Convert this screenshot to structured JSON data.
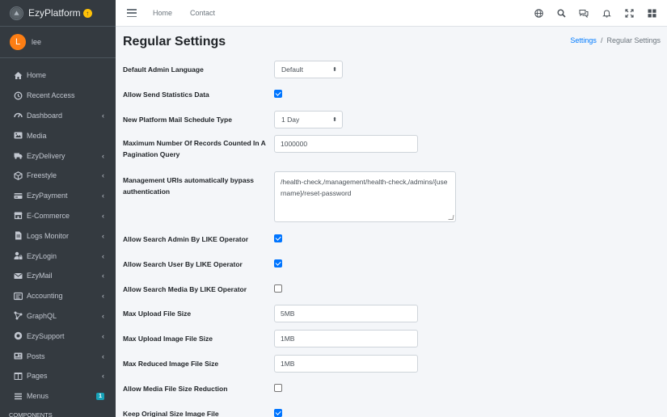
{
  "brand": {
    "name": "EzyPlatform"
  },
  "user": {
    "initial": "L",
    "name": "lee"
  },
  "sidebar": {
    "items": [
      {
        "label": "Home",
        "icon": "home-icon",
        "chevron": false
      },
      {
        "label": "Recent Access",
        "icon": "history-icon",
        "chevron": false
      },
      {
        "label": "Dashboard",
        "icon": "dashboard-icon",
        "chevron": true
      },
      {
        "label": "Media",
        "icon": "image-icon",
        "chevron": false
      },
      {
        "label": "EzyDelivery",
        "icon": "truck-icon",
        "chevron": true
      },
      {
        "label": "Freestyle",
        "icon": "cube-icon",
        "chevron": true
      },
      {
        "label": "EzyPayment",
        "icon": "payment-icon",
        "chevron": true
      },
      {
        "label": "E-Commerce",
        "icon": "store-icon",
        "chevron": true
      },
      {
        "label": "Logs Monitor",
        "icon": "file-icon",
        "chevron": true
      },
      {
        "label": "EzyLogin",
        "icon": "user-lock-icon",
        "chevron": true
      },
      {
        "label": "EzyMail",
        "icon": "mail-icon",
        "chevron": true
      },
      {
        "label": "Accounting",
        "icon": "accounting-icon",
        "chevron": true
      },
      {
        "label": "GraphQL",
        "icon": "graph-icon",
        "chevron": true
      },
      {
        "label": "EzySupport",
        "icon": "support-icon",
        "chevron": true
      },
      {
        "label": "Posts",
        "icon": "posts-icon",
        "chevron": true
      },
      {
        "label": "Pages",
        "icon": "pages-icon",
        "chevron": true
      },
      {
        "label": "Menus",
        "icon": "menu-icon",
        "badge": "1"
      }
    ],
    "header": "COMPONENTS"
  },
  "topbar": {
    "links": [
      "Home",
      "Contact"
    ],
    "icons": [
      "globe-icon",
      "search-icon",
      "chat-icon",
      "bell-icon",
      "fullscreen-icon",
      "apps-icon"
    ]
  },
  "page": {
    "title": "Regular Settings",
    "breadcrumb": {
      "parent": "Settings",
      "separator": "/",
      "current": "Regular Settings"
    }
  },
  "settings": {
    "admin_language": {
      "label": "Default Admin Language",
      "value": "Default"
    },
    "send_statistics": {
      "label": "Allow Send Statistics Data",
      "checked": true
    },
    "mail_schedule": {
      "label": "New Platform Mail Schedule Type",
      "value": "1 Day"
    },
    "max_records": {
      "label": "Maximum Number Of Records Counted In A Pagination Query",
      "value": "1000000"
    },
    "bypass_uris": {
      "label": "Management URIs automatically bypass authentication",
      "value": "/health-check,/management/health-check,/admins/{username}/reset-password"
    },
    "search_admin_like": {
      "label": "Allow Search Admin By LIKE Operator",
      "checked": true
    },
    "search_user_like": {
      "label": "Allow Search User By LIKE Operator",
      "checked": true
    },
    "search_media_like": {
      "label": "Allow Search Media By LIKE Operator",
      "checked": false
    },
    "max_upload_size": {
      "label": "Max Upload File Size",
      "value": "5MB"
    },
    "max_image_size": {
      "label": "Max Upload Image File Size",
      "value": "1MB"
    },
    "max_reduced_size": {
      "label": "Max Reduced Image File Size",
      "value": "1MB"
    },
    "media_reduction": {
      "label": "Allow Media File Size Reduction",
      "checked": false
    },
    "keep_original": {
      "label": "Keep Original Size Image File",
      "checked": true
    }
  },
  "colors": {
    "sidebar_bg": "#343a40",
    "accent": "#007bff",
    "checkbox": "#0075ff"
  }
}
